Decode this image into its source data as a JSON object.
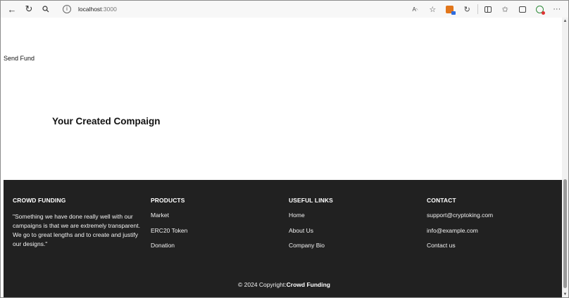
{
  "browser": {
    "url_host": "localhost",
    "url_port": ":3000",
    "icons": [
      "back-icon",
      "refresh-icon",
      "search-icon",
      "info-icon",
      "read-aloud-icon",
      "favorite-star-icon",
      "metamask-extension-icon",
      "copilot-icon",
      "split-screen-icon",
      "favorites-icon",
      "collections-icon",
      "extension-icon",
      "more-icon"
    ]
  },
  "main": {
    "send_fund_label": "Send Fund",
    "created_title": "Your Created Compaign"
  },
  "footer": {
    "about": {
      "heading": "CROWD FUNDING",
      "text": "\"Something we have done really well with our campaigns is that we are extremely transparent. We go to great lengths and to create and justify our designs.\""
    },
    "products": {
      "heading": "PRODUCTS",
      "links": [
        "Market",
        "ERC20 Token",
        "Donation"
      ]
    },
    "useful_links": {
      "heading": "USEFUL LINKS",
      "links": [
        "Home",
        "About Us",
        "Company Bio"
      ]
    },
    "contact": {
      "heading": "CONTACT",
      "links": [
        "support@cryptoking.com",
        "info@example.com",
        "Contact us"
      ]
    },
    "copyright_prefix": "© 2024 Copyright:",
    "copyright_brand": "Crowd Funding"
  },
  "colors": {
    "footer_bg": "#212121",
    "page_bg": "#ffffff"
  }
}
